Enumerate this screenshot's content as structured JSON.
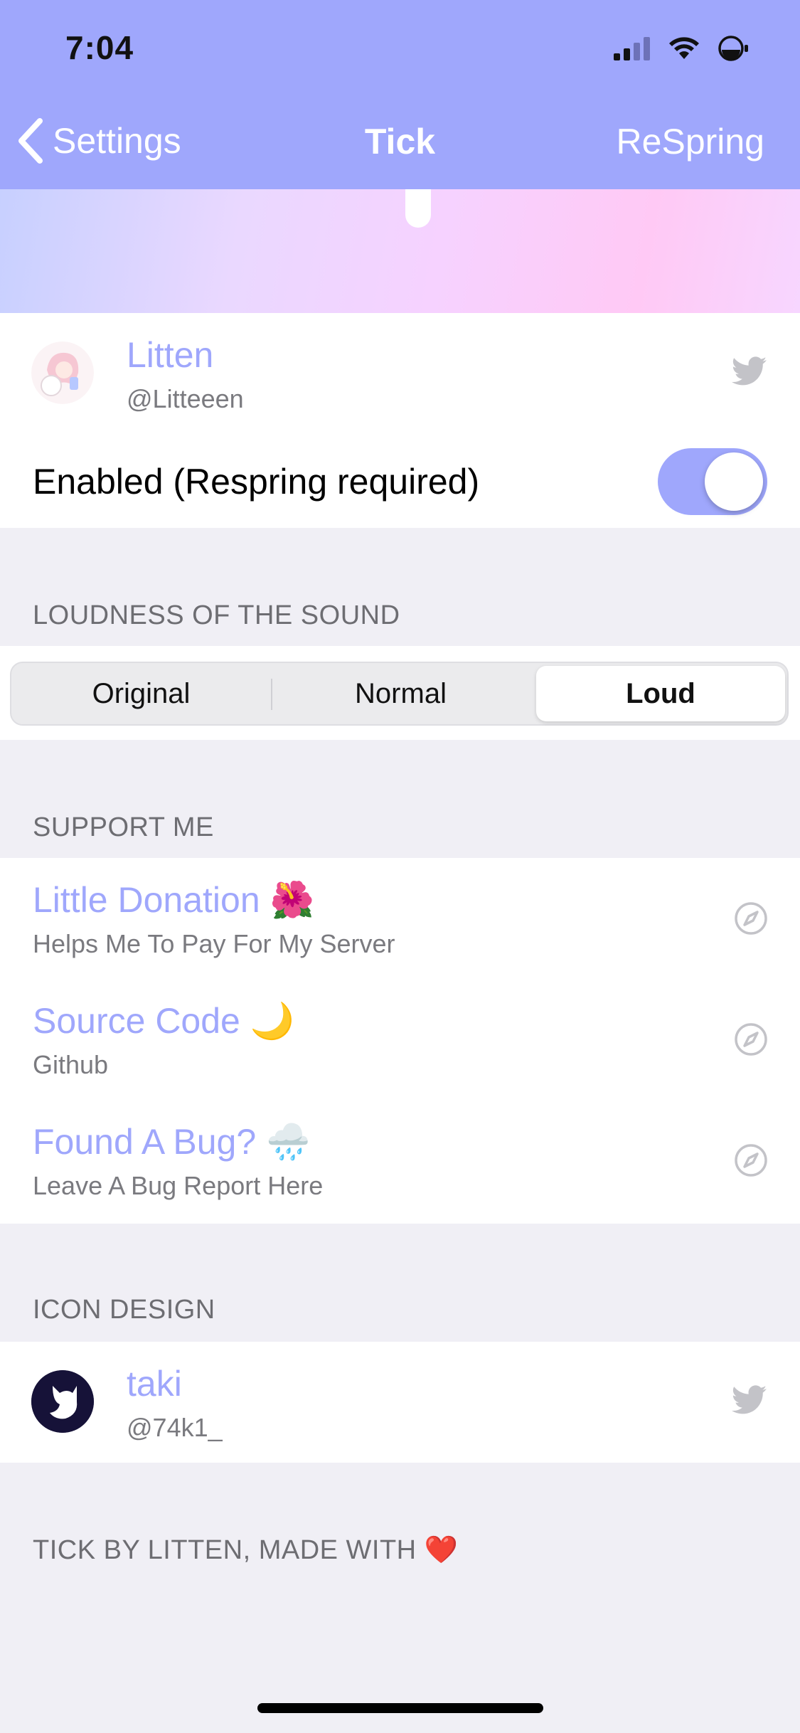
{
  "status_bar": {
    "time": "7:04"
  },
  "nav": {
    "back_label": "Settings",
    "title": "Tick",
    "right_button": "ReSpring"
  },
  "author": {
    "name": "Litten",
    "handle": "@Litteeen"
  },
  "enabled_label": "Enabled (Respring required)",
  "enabled": true,
  "loudness": {
    "header": "LOUDNESS OF THE SOUND",
    "options": [
      "Original",
      "Normal",
      "Loud"
    ],
    "selected": "Loud"
  },
  "support": {
    "header": "SUPPORT ME",
    "items": [
      {
        "title": "Little Donation",
        "emoji": "🌺",
        "subtitle": "Helps Me To Pay For My Server"
      },
      {
        "title": "Source Code",
        "emoji": "🌙",
        "subtitle": "Github"
      },
      {
        "title": "Found A Bug?",
        "emoji": "🌧️",
        "subtitle": "Leave A Bug Report Here"
      }
    ]
  },
  "icon_design": {
    "header": "ICON DESIGN",
    "name": "taki",
    "handle": "@74k1_"
  },
  "footer": {
    "text": "TICK BY LITTEN, MADE WITH",
    "emoji": "❤️"
  },
  "colors": {
    "accent": "#9fa7fc",
    "nav_bg": "#9fa7fc",
    "page_bg": "#f0eff5"
  }
}
